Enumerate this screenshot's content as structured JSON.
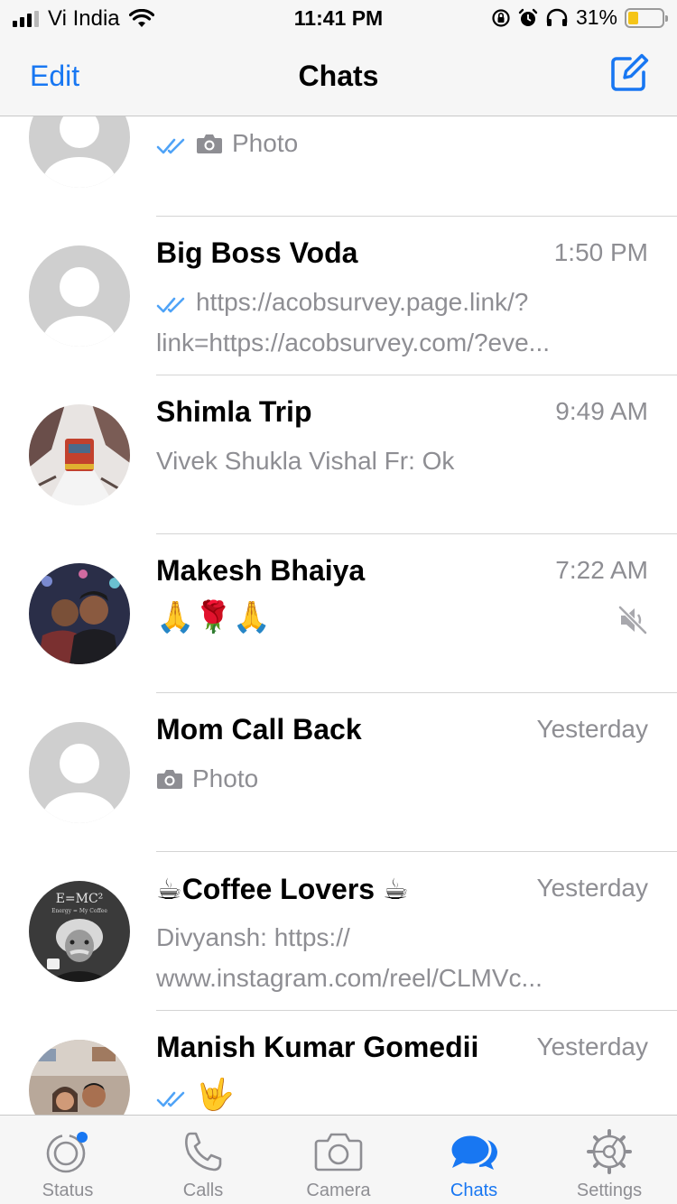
{
  "status_bar": {
    "carrier": "Vi India",
    "time": "11:41 PM",
    "battery_percent": "31%",
    "battery_level": 0.31,
    "icons": [
      "signal-icon",
      "wifi-icon",
      "orientation-lock-icon",
      "alarm-icon",
      "headphones-icon",
      "battery-icon"
    ]
  },
  "nav": {
    "edit_label": "Edit",
    "title": "Chats",
    "compose_icon": "compose-icon"
  },
  "chats": [
    {
      "name": "",
      "time": "",
      "preview_line1": "Photo",
      "preview_line2": "",
      "ticks": true,
      "camera": true,
      "muted": false
    },
    {
      "name": "Big Boss Voda",
      "time": "1:50 PM",
      "preview_line1": "https://acobsurvey.page.link/?",
      "preview_line2": "link=https://acobsurvey.com/?eve...",
      "ticks": true,
      "camera": false,
      "muted": false
    },
    {
      "name": "Shimla Trip",
      "time": "9:49 AM",
      "preview_line1": "Vivek Shukla Vishal Fr: Ok",
      "preview_line2": "",
      "ticks": false,
      "camera": false,
      "muted": false
    },
    {
      "name": "Makesh Bhaiya",
      "time": "7:22 AM",
      "preview_line1": "🙏🌹🙏",
      "preview_line2": "",
      "ticks": false,
      "camera": false,
      "muted": true
    },
    {
      "name": "Mom Call Back",
      "time": "Yesterday",
      "preview_line1": "Photo",
      "preview_line2": "",
      "ticks": false,
      "camera": true,
      "muted": false
    },
    {
      "name": "☕Coffee Lovers ☕",
      "time": "Yesterday",
      "preview_line1": "Divyansh: https://",
      "preview_line2": "www.instagram.com/reel/CLMVc...",
      "ticks": false,
      "camera": false,
      "muted": false
    },
    {
      "name": "Manish Kumar Gomedii",
      "time": "Yesterday",
      "preview_line1": "🤟",
      "preview_line2": "",
      "ticks": true,
      "camera": false,
      "muted": false
    }
  ],
  "avatar_texts": {
    "coffee_lovers_formula": "E=MC²",
    "coffee_lovers_subtext": "Energy = My Coffee"
  },
  "tabs": [
    {
      "label": "Status",
      "icon": "status-icon",
      "active": false
    },
    {
      "label": "Calls",
      "icon": "phone-icon",
      "active": false
    },
    {
      "label": "Camera",
      "icon": "camera-icon",
      "active": false
    },
    {
      "label": "Chats",
      "icon": "chats-icon",
      "active": true
    },
    {
      "label": "Settings",
      "icon": "gear-icon",
      "active": false
    }
  ],
  "colors": {
    "accent": "#1877f2",
    "secondary_text": "#8e8e93",
    "bar_background": "#f6f6f6",
    "read_ticks": "#4fa3f7"
  }
}
